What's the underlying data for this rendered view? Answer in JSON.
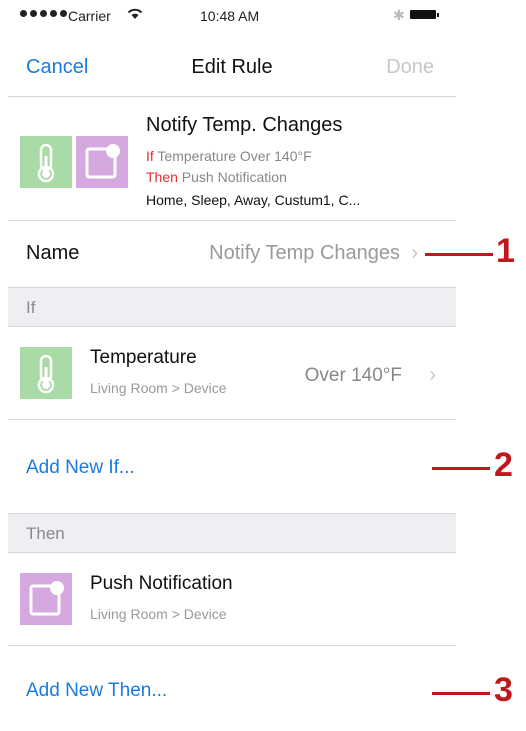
{
  "status_bar": {
    "carrier": "Carrier",
    "time": "10:48 AM"
  },
  "nav": {
    "cancel": "Cancel",
    "title": "Edit Rule",
    "done": "Done"
  },
  "summary": {
    "title": "Notify Temp. Changes",
    "if_keyword": "If",
    "if_text": " Temperature Over 140°F",
    "then_keyword": "Then",
    "then_text": " Push Notification",
    "modes": "Home, Sleep, Away, Custum1, C..."
  },
  "name_row": {
    "label": "Name",
    "value": "Notify Temp Changes"
  },
  "if_section": {
    "header": "If",
    "item": {
      "title": "Temperature",
      "subtitle": "Living Room > Device",
      "value": "Over 140°F"
    },
    "add_label": "Add New If..."
  },
  "then_section": {
    "header": "Then",
    "item": {
      "title": "Push Notification",
      "subtitle": "Living Room > Device"
    },
    "add_label": "Add New Then..."
  },
  "callouts": [
    "1",
    "2",
    "3"
  ],
  "colors": {
    "accent": "#1a7be0",
    "keyword_red": "#e03030",
    "callout_red": "#c0161c",
    "tile_green": "#a8dba5",
    "tile_purple": "#d5a9df"
  }
}
